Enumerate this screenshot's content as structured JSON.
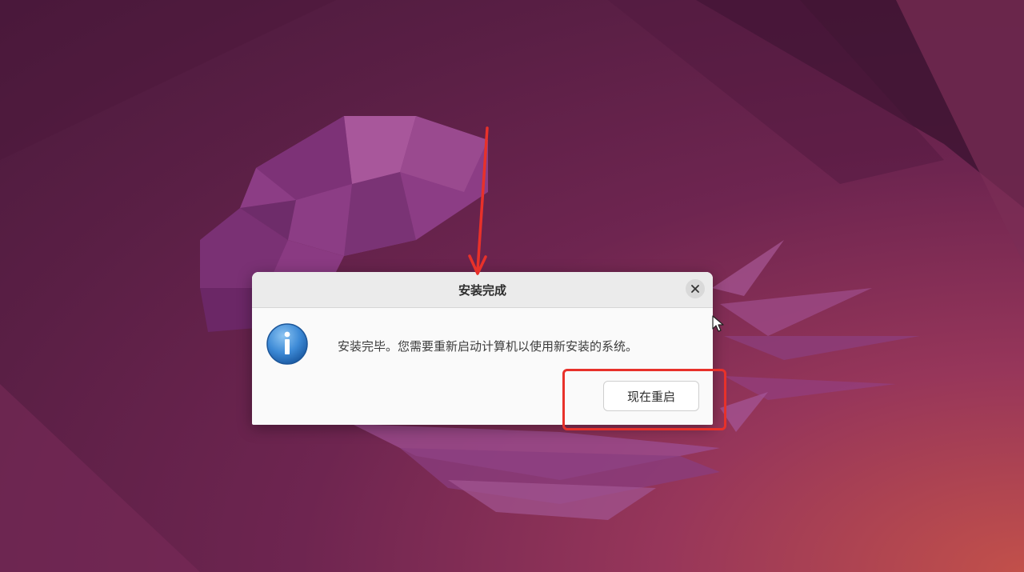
{
  "dialog": {
    "title": "安装完成",
    "message": "安装完毕。您需要重新启动计算机以使用新安装的系统。",
    "restart_label": "现在重启"
  },
  "icons": {
    "info": "info-icon",
    "close": "close-icon",
    "cursor": "mouse-pointer-icon"
  },
  "colors": {
    "annotation": "#e8312a",
    "info_icon_blue": "#3d8ad6",
    "dialog_bg": "#fafafa",
    "titlebar_bg": "#ebebeb"
  }
}
